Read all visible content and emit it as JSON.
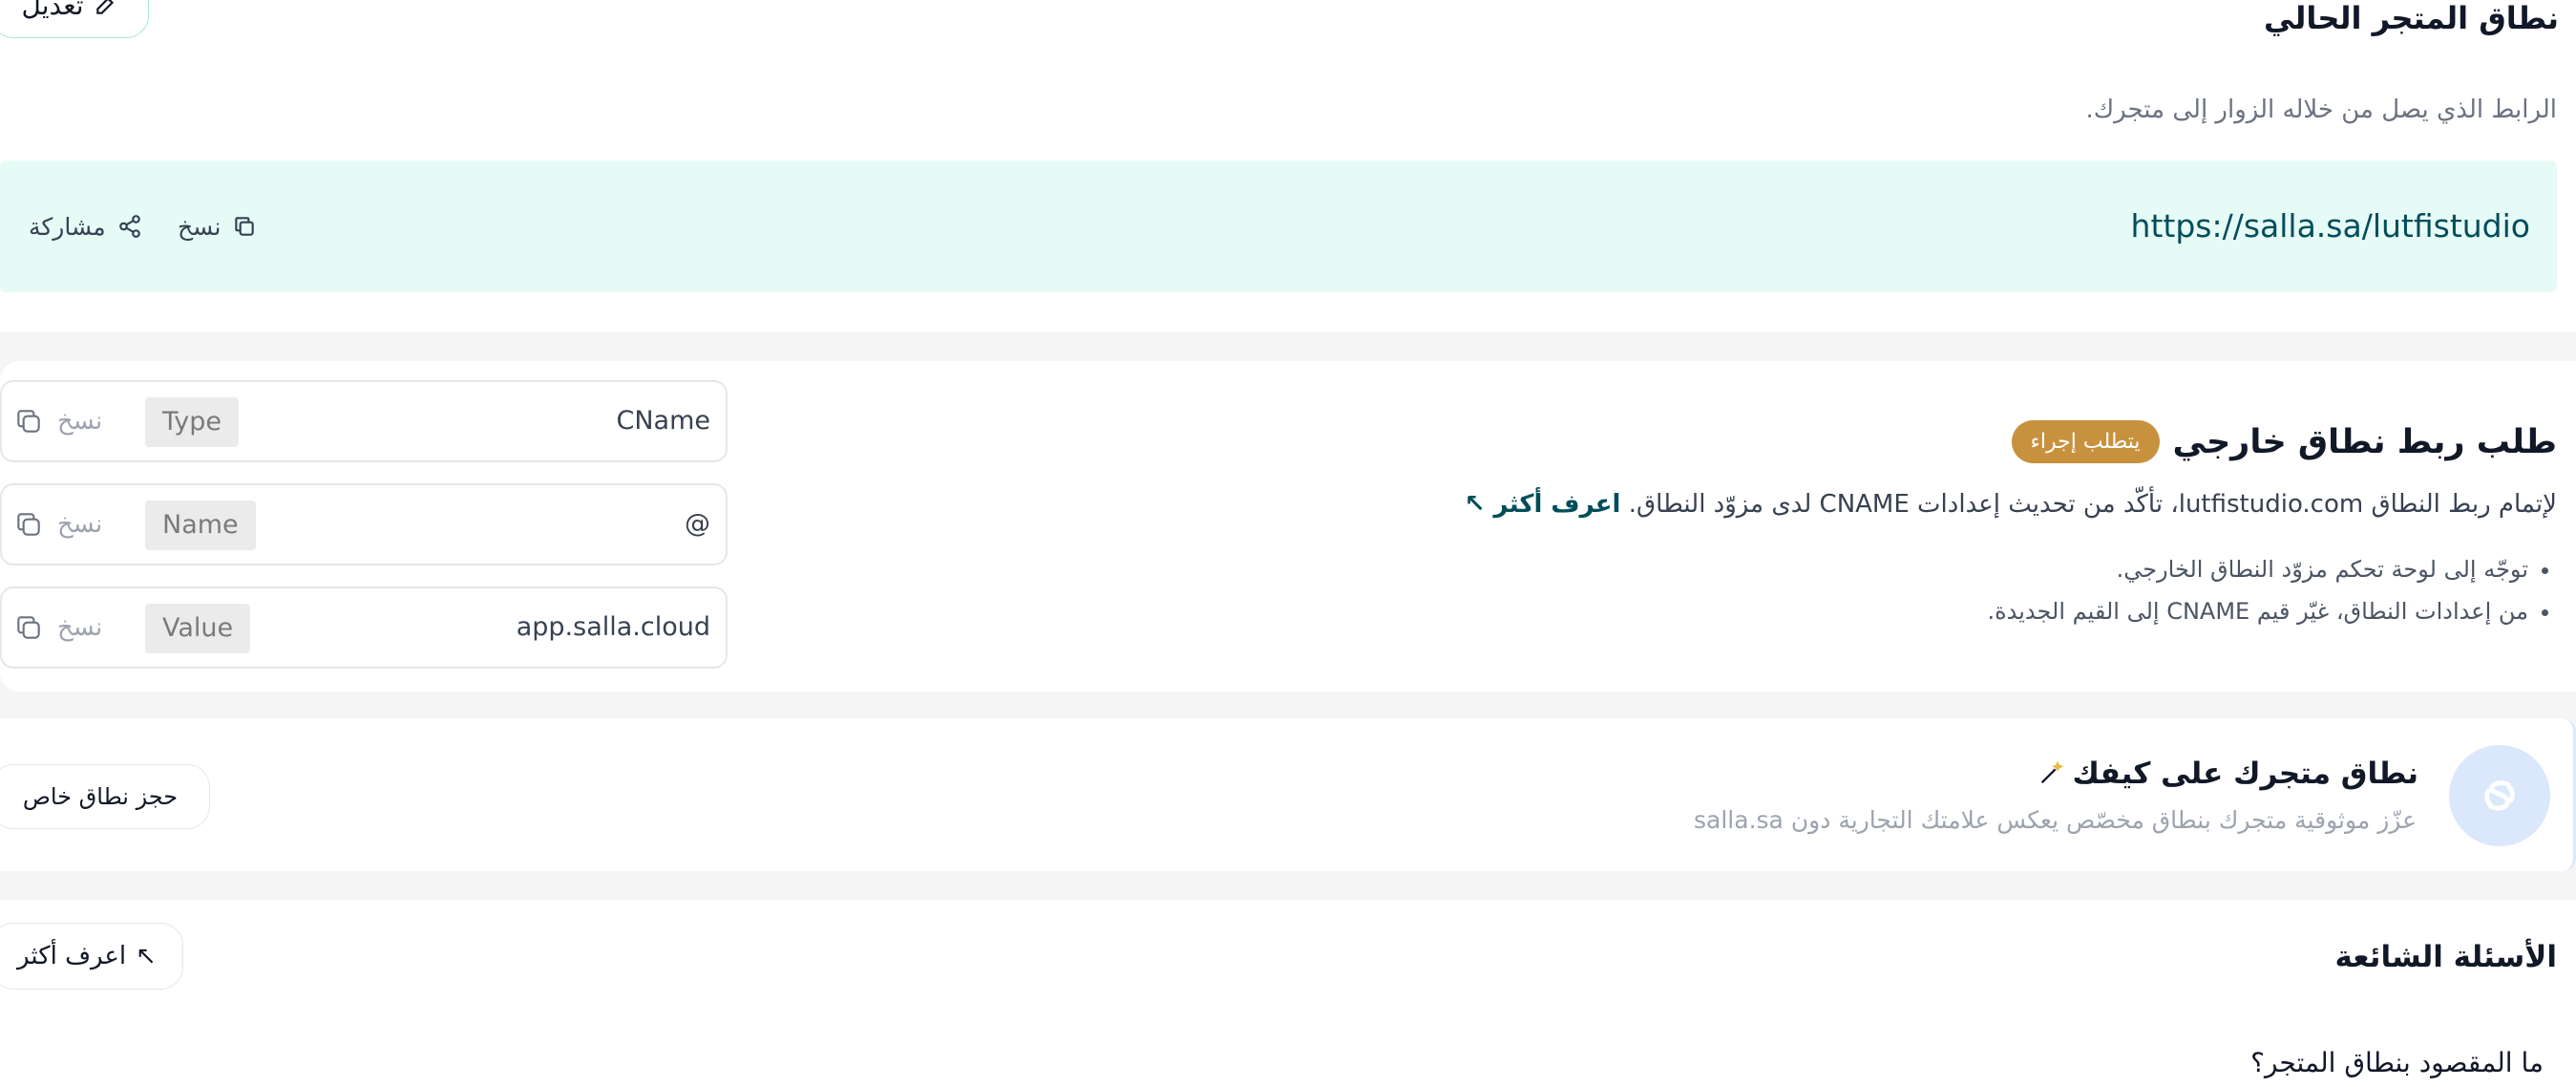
{
  "current_domain": {
    "edit_label": "تعديل",
    "title": "نطاق المتجر الحالي",
    "description": "الرابط الذي يصل من خلاله الزوار إلى متجرك.",
    "url": "https://salla.sa/lutfistudio",
    "copy_label": "نسخ",
    "share_label": "مشاركة"
  },
  "external_domain": {
    "title": "طلب ربط نطاق خارجي",
    "badge": "يتطلب إجراء",
    "description": "لإتمام ربط النطاق lutfistudio.com، تأكّد من تحديث إعدادات CNAME لدى مزوّد النطاق.",
    "learn_more": "اعرف أكثر",
    "steps": [
      "توجّه إلى لوحة تحكم مزوّد النطاق الخارجي.",
      "من إعدادات النطاق، غيّر قيم CNAME إلى القيم الجديدة."
    ],
    "records": [
      {
        "value": "CName",
        "chip": "Type",
        "copy": "نسخ"
      },
      {
        "value": "@",
        "chip": "Name",
        "copy": "نسخ"
      },
      {
        "value": "app.salla.cloud",
        "chip": "Value",
        "copy": "نسخ"
      }
    ]
  },
  "custom_domain": {
    "title": "نطاق متجرك على كيفك",
    "subtitle": "عزّز موثوقية متجرك بنطاق مخصّص يعكس علامتك التجارية دون salla.sa",
    "button": "حجز نطاق خاص"
  },
  "faq": {
    "title": "الأسئلة الشائعة",
    "learn_more": "اعرف أكثر",
    "question": "ما المقصود بنطاق المتجر؟"
  },
  "colors": {
    "url_box_bg": "#e6fbf6",
    "badge_bg": "#c8913e",
    "accent_dark": "#004d5a",
    "logo_circle": "#dbe8fb"
  }
}
